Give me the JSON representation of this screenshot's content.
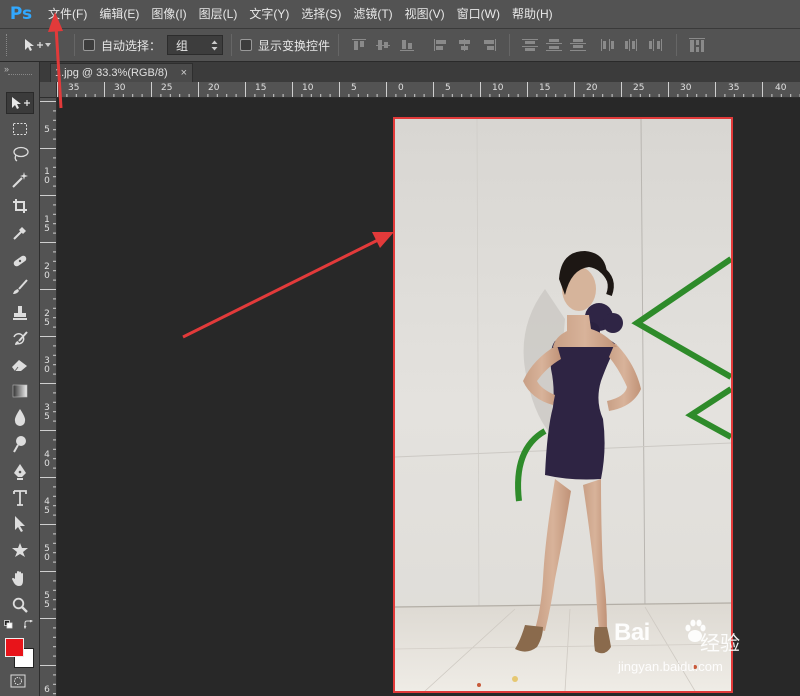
{
  "app": {
    "logo": "Ps"
  },
  "menu": [
    "文件(F)",
    "编辑(E)",
    "图像(I)",
    "图层(L)",
    "文字(Y)",
    "选择(S)",
    "滤镜(T)",
    "视图(V)",
    "窗口(W)",
    "帮助(H)"
  ],
  "options": {
    "auto_select_label": "自动选择：",
    "auto_select_value": "组",
    "show_transform_label": "显示变换控件"
  },
  "document": {
    "tab_title": "1.jpg @ 33.3%(RGB/8)",
    "close_glyph": "×"
  },
  "ruler_top": [
    "35",
    "30",
    "25",
    "20",
    "15",
    "10",
    "5",
    "0",
    "5",
    "10",
    "15",
    "20",
    "25",
    "30",
    "35",
    "40"
  ],
  "ruler_left": [
    "5",
    "1\n0",
    "1\n5",
    "2\n0",
    "2\n5",
    "3\n0",
    "3\n5",
    "4\n0",
    "4\n5",
    "5\n0",
    "5\n5",
    "6"
  ],
  "tools": [
    "move-tool-icon",
    "marquee-tool-icon",
    "lasso-tool-icon",
    "magic-wand-icon",
    "crop-tool-icon",
    "eyedropper-icon",
    "healing-brush-icon",
    "brush-tool-icon",
    "clone-stamp-icon",
    "history-brush-icon",
    "eraser-icon",
    "gradient-icon",
    "blur-icon",
    "dodge-icon",
    "pen-tool-icon",
    "type-tool-icon",
    "path-selection-icon",
    "custom-shape-icon",
    "hand-tool-icon",
    "zoom-tool-icon"
  ],
  "colors": {
    "foreground": "#e8141a",
    "background": "#ffffff",
    "annotation": "#e23a3a",
    "accent": "#31a8ff"
  },
  "watermark": {
    "brand": "Bai",
    "brand_suffix": "经验",
    "url": "jingyan.baidu.com"
  }
}
